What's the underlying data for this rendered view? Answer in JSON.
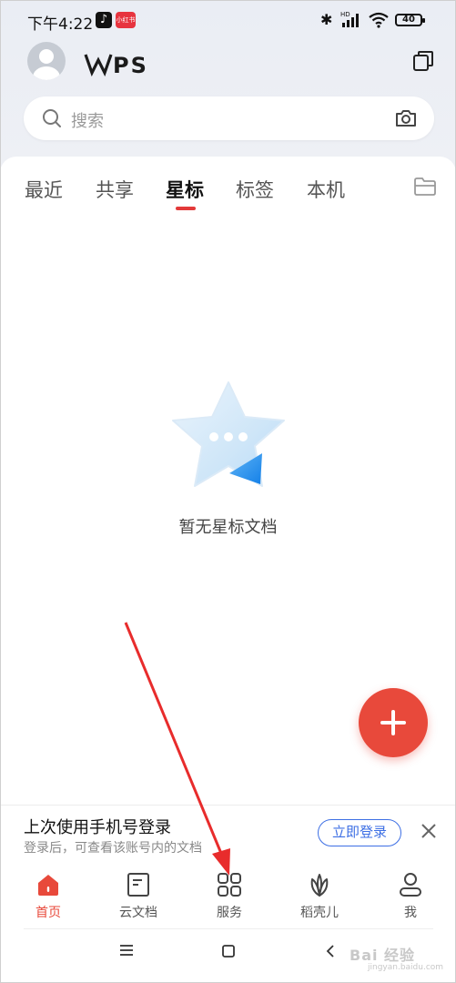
{
  "status_bar": {
    "time": "下午4:22",
    "battery": "40",
    "red_app_label": "小红书"
  },
  "header": {
    "logo_text": "WPS"
  },
  "search": {
    "placeholder": "搜索"
  },
  "tabs": [
    {
      "label": "最近"
    },
    {
      "label": "共享"
    },
    {
      "label": "星标"
    },
    {
      "label": "标签"
    },
    {
      "label": "本机"
    }
  ],
  "active_tab": "星标",
  "empty_state": {
    "message": "暂无星标文档"
  },
  "login_banner": {
    "title": "上次使用手机号登录",
    "subtitle": "登录后，可查看该账号内的文档",
    "button_label": "立即登录"
  },
  "bottom_nav": [
    {
      "label": "首页",
      "icon": "home-icon",
      "active": true
    },
    {
      "label": "云文档",
      "icon": "cloud-doc-icon",
      "active": false
    },
    {
      "label": "服务",
      "icon": "apps-grid-icon",
      "active": false
    },
    {
      "label": "稻壳儿",
      "icon": "leaf-icon",
      "active": false
    },
    {
      "label": "我",
      "icon": "person-icon",
      "active": false
    }
  ],
  "watermark": {
    "main": "Bai 经验",
    "sub": "jingyan.baidu.com"
  },
  "colors": {
    "accent": "#e8493b",
    "link_blue": "#3d6fe4",
    "tab_indicator": "#e33a3a"
  }
}
